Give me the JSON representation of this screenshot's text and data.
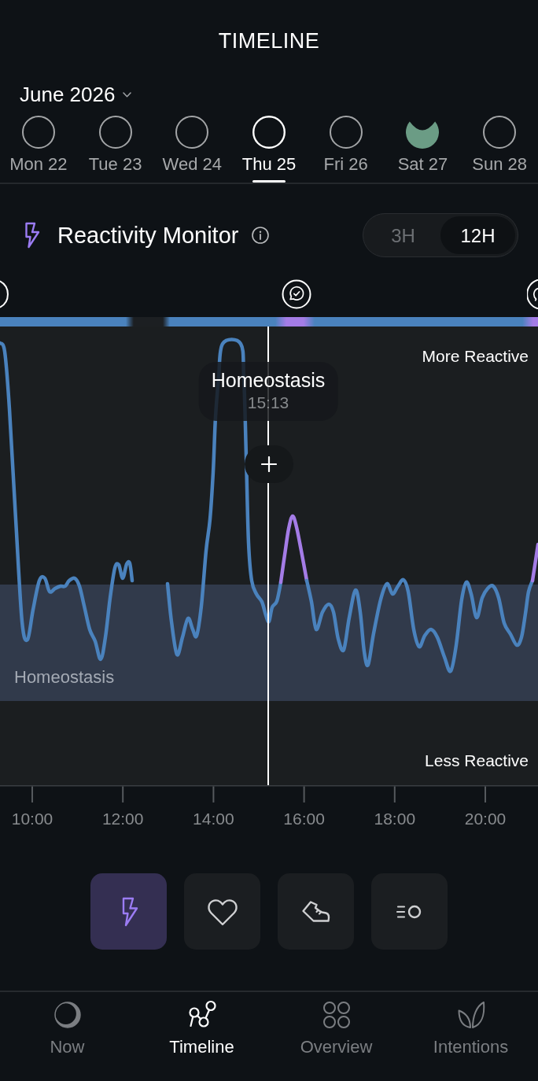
{
  "header": {
    "title": "TIMELINE"
  },
  "month_picker": {
    "label": "June 2026"
  },
  "days": [
    {
      "label": "Mon 22",
      "selected": false
    },
    {
      "label": "Tue 23",
      "selected": false
    },
    {
      "label": "Wed 24",
      "selected": false
    },
    {
      "label": "Thu 25",
      "selected": true
    },
    {
      "label": "Fri 26",
      "selected": false
    },
    {
      "label": "Sat 27",
      "selected": false,
      "level": 0.8
    },
    {
      "label": "Sun 28",
      "selected": false
    }
  ],
  "monitor": {
    "title": "Reactivity Monitor",
    "ranges": [
      {
        "label": "3H",
        "selected": false
      },
      {
        "label": "12H",
        "selected": true
      }
    ],
    "chart": {
      "upper_label": "More Reactive",
      "tooltip": {
        "title": "Homeostasis",
        "time": "15:13"
      },
      "band_label": "Homeostasis",
      "lower_label": "Less Reactive",
      "x_axis_labels": [
        "10:00",
        "12:00",
        "14:00",
        "16:00",
        "18:00",
        "20:00"
      ]
    }
  },
  "metric_buttons": [
    {
      "kind": "reactivity",
      "selected": true
    },
    {
      "kind": "heart",
      "selected": false
    },
    {
      "kind": "shoe",
      "selected": false
    },
    {
      "kind": "breath",
      "selected": false
    }
  ],
  "nav": [
    {
      "label": "Now",
      "kind": "moon",
      "selected": false
    },
    {
      "label": "Timeline",
      "kind": "graph",
      "selected": true
    },
    {
      "label": "Overview",
      "kind": "circles",
      "selected": false
    },
    {
      "label": "Intentions",
      "kind": "leaves",
      "selected": false
    }
  ]
}
